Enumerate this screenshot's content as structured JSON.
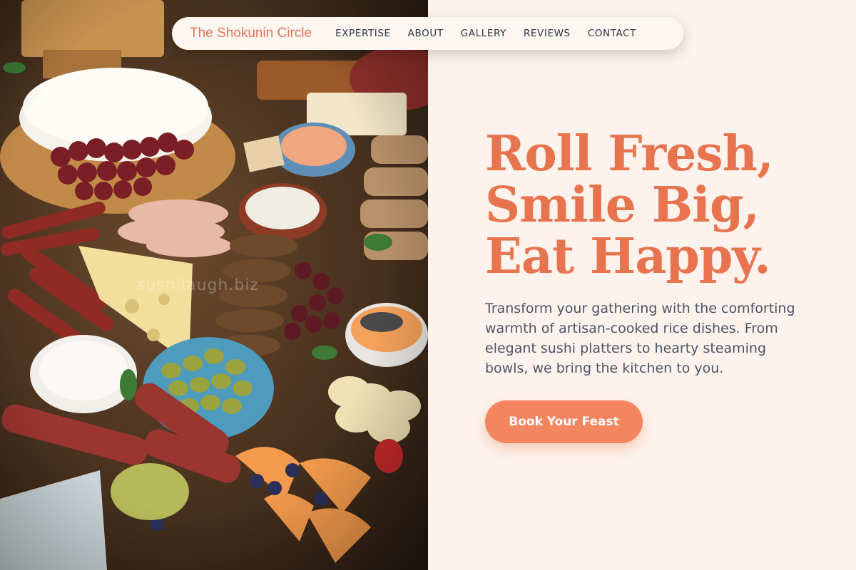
{
  "nav": {
    "brand": "The Shokunin Circle",
    "links": [
      {
        "label": "EXPERTISE"
      },
      {
        "label": "ABOUT"
      },
      {
        "label": "GALLERY"
      },
      {
        "label": "REVIEWS"
      },
      {
        "label": "CONTACT"
      }
    ]
  },
  "hero": {
    "image_watermark": "sushilaugh.biz",
    "headline_lines": [
      "Roll Fresh,",
      "Smile Big,",
      "Eat Happy."
    ],
    "description": "Transform your gathering with the comforting warmth of artisan-cooked rice dishes. From elegant sushi platters to hearty steaming bowls, we bring the kitchen to you.",
    "cta_label": "Book Your Feast"
  },
  "colors": {
    "accent": "#e8734f",
    "button": "#f4865f",
    "background": "#fdf3ec",
    "body_text": "#4a5466",
    "nav_text": "#2e3440"
  }
}
